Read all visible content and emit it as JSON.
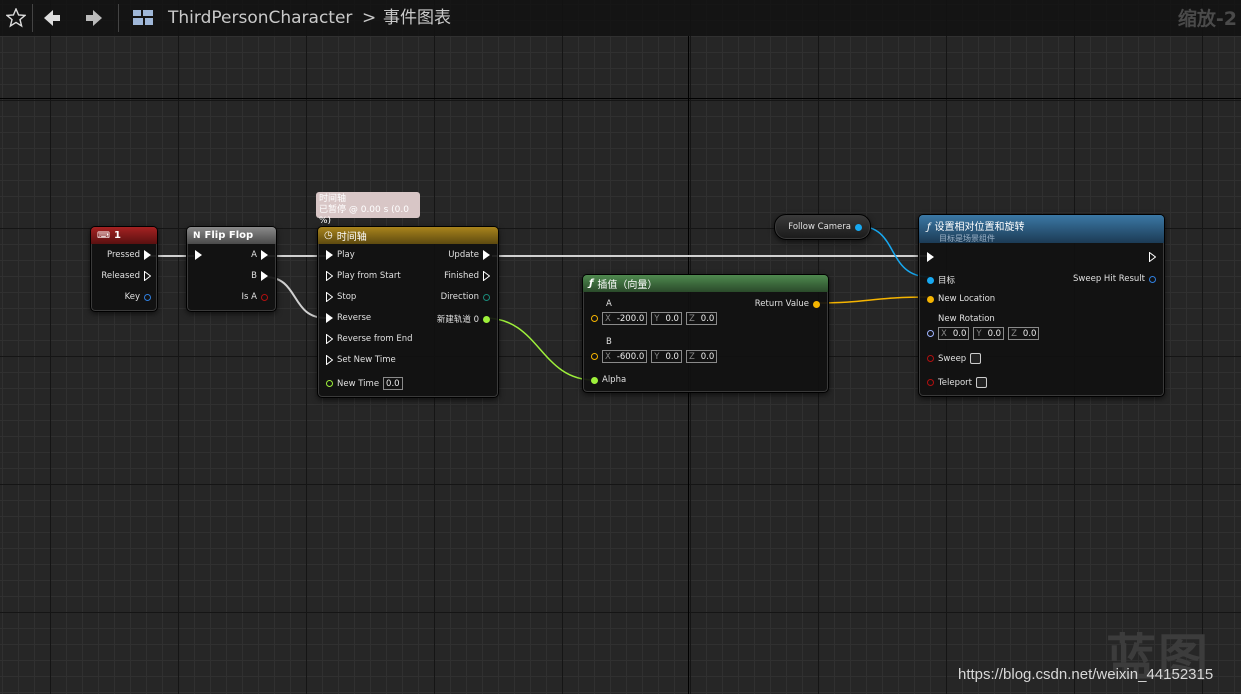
{
  "toolbar": {
    "breadcrumb_blueprint": "ThirdPersonCharacter",
    "breadcrumb_separator": ">",
    "breadcrumb_graph": "事件图表",
    "zoom": "缩放-2"
  },
  "tooltip": {
    "line1": "时间轴",
    "line2": "已暂停 @ 0.00 s (0.0 %)"
  },
  "key_node": {
    "title": "1",
    "pins": [
      "Pressed",
      "Released",
      "Key"
    ]
  },
  "flipflop_node": {
    "title": "Flip Flop",
    "out_a": "A",
    "out_b": "B",
    "is_a": "Is A"
  },
  "timeline_node": {
    "title": "时间轴",
    "inputs": [
      "Play",
      "Play from Start",
      "Stop",
      "Reverse",
      "Reverse from End",
      "Set New Time"
    ],
    "new_time_label": "New Time",
    "new_time_value": "0.0",
    "outputs": [
      "Update",
      "Finished",
      "Direction",
      "新建轨道 0"
    ]
  },
  "lerp_node": {
    "title": "插值（向量）",
    "a_label": "A",
    "a_x": "-200.0",
    "a_y": "0.0",
    "a_z": "0.0",
    "b_label": "B",
    "b_x": "-600.0",
    "b_y": "0.0",
    "b_z": "0.0",
    "alpha": "Alpha",
    "return": "Return Value",
    "axis_x": "X",
    "axis_y": "Y",
    "axis_z": "Z"
  },
  "camera_node": {
    "label": "Follow Camera"
  },
  "set_node": {
    "title": "设置相对位置和旋转",
    "subtitle": "目标是场景组件",
    "target": "目标",
    "sweep_hit": "Sweep Hit Result",
    "new_location": "New Location",
    "new_rotation": "New Rotation",
    "rot_x": "0.0",
    "rot_y": "0.0",
    "rot_z": "0.0",
    "sweep": "Sweep",
    "teleport": "Teleport"
  },
  "watermark": {
    "logo": "蓝图",
    "url": "https://blog.csdn.net/weixin_44152315"
  },
  "colors": {
    "exec": "#ffffff",
    "vector": "#f5b400",
    "float": "#9ef03b",
    "object": "#17a8f0",
    "bool": "#8b0000",
    "rotator": "#a0b4ff",
    "key_header": "#8b1c1c",
    "timeline_header": "#8a6a14",
    "lerp_header": "#3b6b3b",
    "set_header": "#2c5b7e"
  }
}
